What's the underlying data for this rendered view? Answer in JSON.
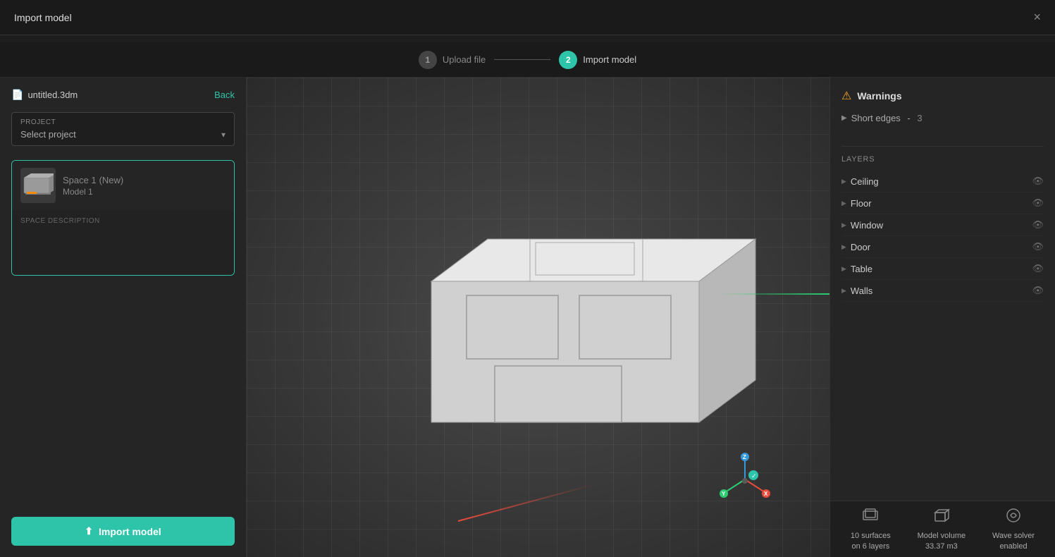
{
  "titleBar": {
    "title": "Import model",
    "closeLabel": "×"
  },
  "stepper": {
    "step1": {
      "number": "1",
      "label": "Upload file",
      "state": "inactive"
    },
    "step2": {
      "number": "2",
      "label": "Import model",
      "state": "active"
    }
  },
  "leftPanel": {
    "fileName": "untitled.3dm",
    "backLabel": "Back",
    "project": {
      "label": "PROJECT",
      "placeholder": "Select project"
    },
    "spaceCard": {
      "spaceName": "Space 1",
      "spaceTag": "(New)",
      "modelName": "Model 1",
      "descriptionLabel": "SPACE DESCRIPTION",
      "descriptionPlaceholder": ""
    },
    "importButtonLabel": "Import model"
  },
  "rightPanel": {
    "warningsTitle": "Warnings",
    "warnings": [
      {
        "label": "Short edges",
        "separator": "-",
        "count": "3"
      }
    ],
    "layersTitle": "LAYERS",
    "layers": [
      {
        "name": "Ceiling"
      },
      {
        "name": "Floor"
      },
      {
        "name": "Window"
      },
      {
        "name": "Door"
      },
      {
        "name": "Table"
      },
      {
        "name": "Walls"
      }
    ]
  },
  "stats": [
    {
      "icon": "⬡",
      "line1": "10 surfaces",
      "line2": "on 6 layers"
    },
    {
      "icon": "⬡",
      "line1": "Model volume",
      "line2": "33.37 m3"
    },
    {
      "icon": "⬡",
      "line1": "Wave solver",
      "line2": "enabled"
    }
  ]
}
